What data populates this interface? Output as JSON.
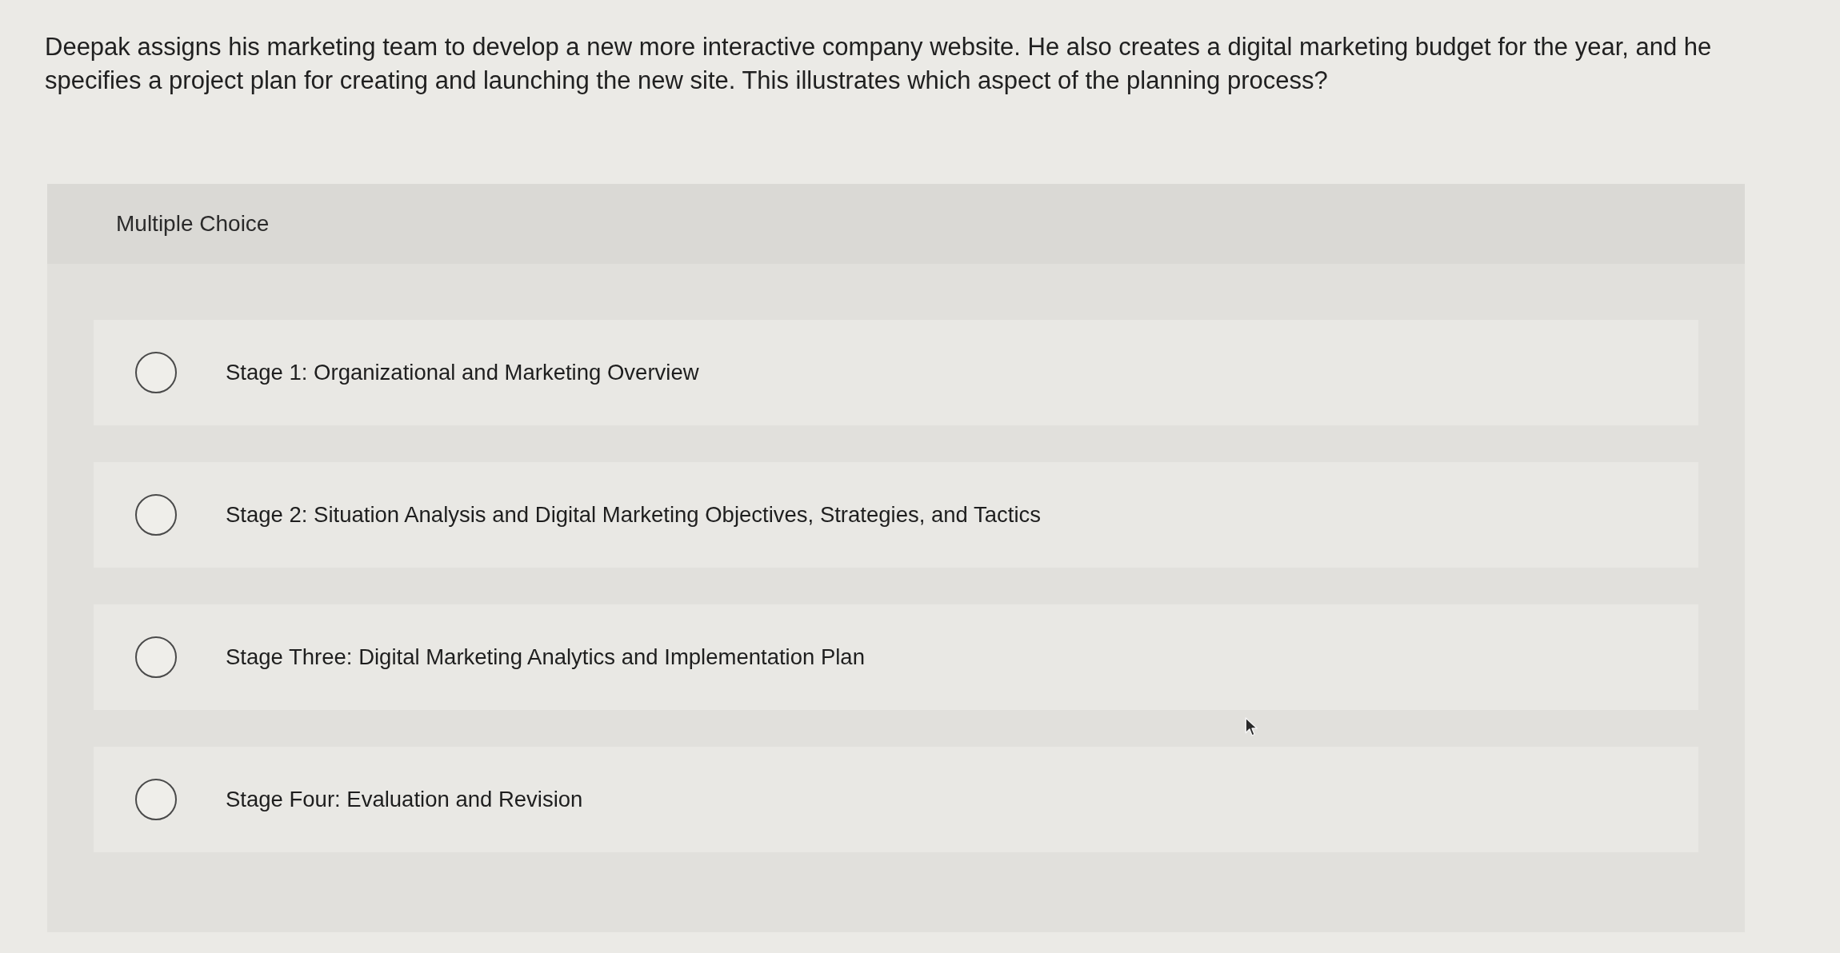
{
  "question": "Deepak assigns his marketing team to develop a new more interactive company website. He also creates a digital marketing budget for the year, and he specifies a project plan for creating and launching the new site. This illustrates which aspect of the planning process?",
  "panel": {
    "title": "Multiple Choice"
  },
  "options": [
    {
      "label": "Stage 1: Organizational and Marketing Overview",
      "selected": false
    },
    {
      "label": "Stage 2: Situation Analysis and Digital Marketing Objectives, Strategies, and Tactics",
      "selected": false
    },
    {
      "label": "Stage Three: Digital Marketing Analytics and Implementation Plan",
      "selected": false
    },
    {
      "label": "Stage Four: Evaluation and Revision",
      "selected": false
    }
  ]
}
